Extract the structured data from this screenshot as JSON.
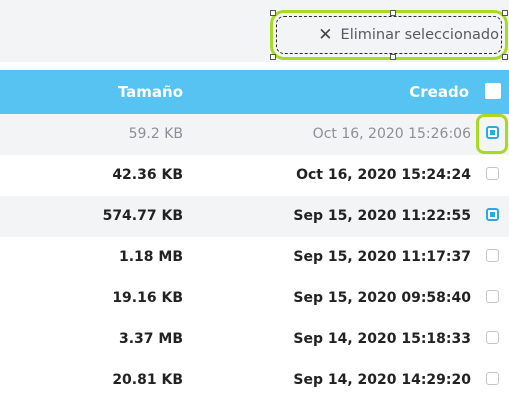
{
  "toolbar": {
    "delete_selected_label": "Eliminar seleccionado"
  },
  "table": {
    "columns": {
      "size": "Tamaño",
      "created": "Creado"
    },
    "rows": [
      {
        "size": "59.2 KB",
        "created": "Oct 16, 2020 15:26:06",
        "checked": true
      },
      {
        "size": "42.36 KB",
        "created": "Oct 16, 2020 15:24:24",
        "checked": false
      },
      {
        "size": "574.77 KB",
        "created": "Sep 15, 2020 11:22:55",
        "checked": true
      },
      {
        "size": "1.18 MB",
        "created": "Sep 15, 2020 11:17:37",
        "checked": false
      },
      {
        "size": "19.16 KB",
        "created": "Sep 15, 2020 09:58:40",
        "checked": false
      },
      {
        "size": "3.37 MB",
        "created": "Sep 14, 2020 15:18:33",
        "checked": false
      },
      {
        "size": "20.81 KB",
        "created": "Sep 14, 2020 14:29:20",
        "checked": false
      }
    ]
  },
  "colors": {
    "header_bg": "#57c3f3",
    "highlight": "#a8d923",
    "checkbox_accent": "#2ea7e6"
  }
}
